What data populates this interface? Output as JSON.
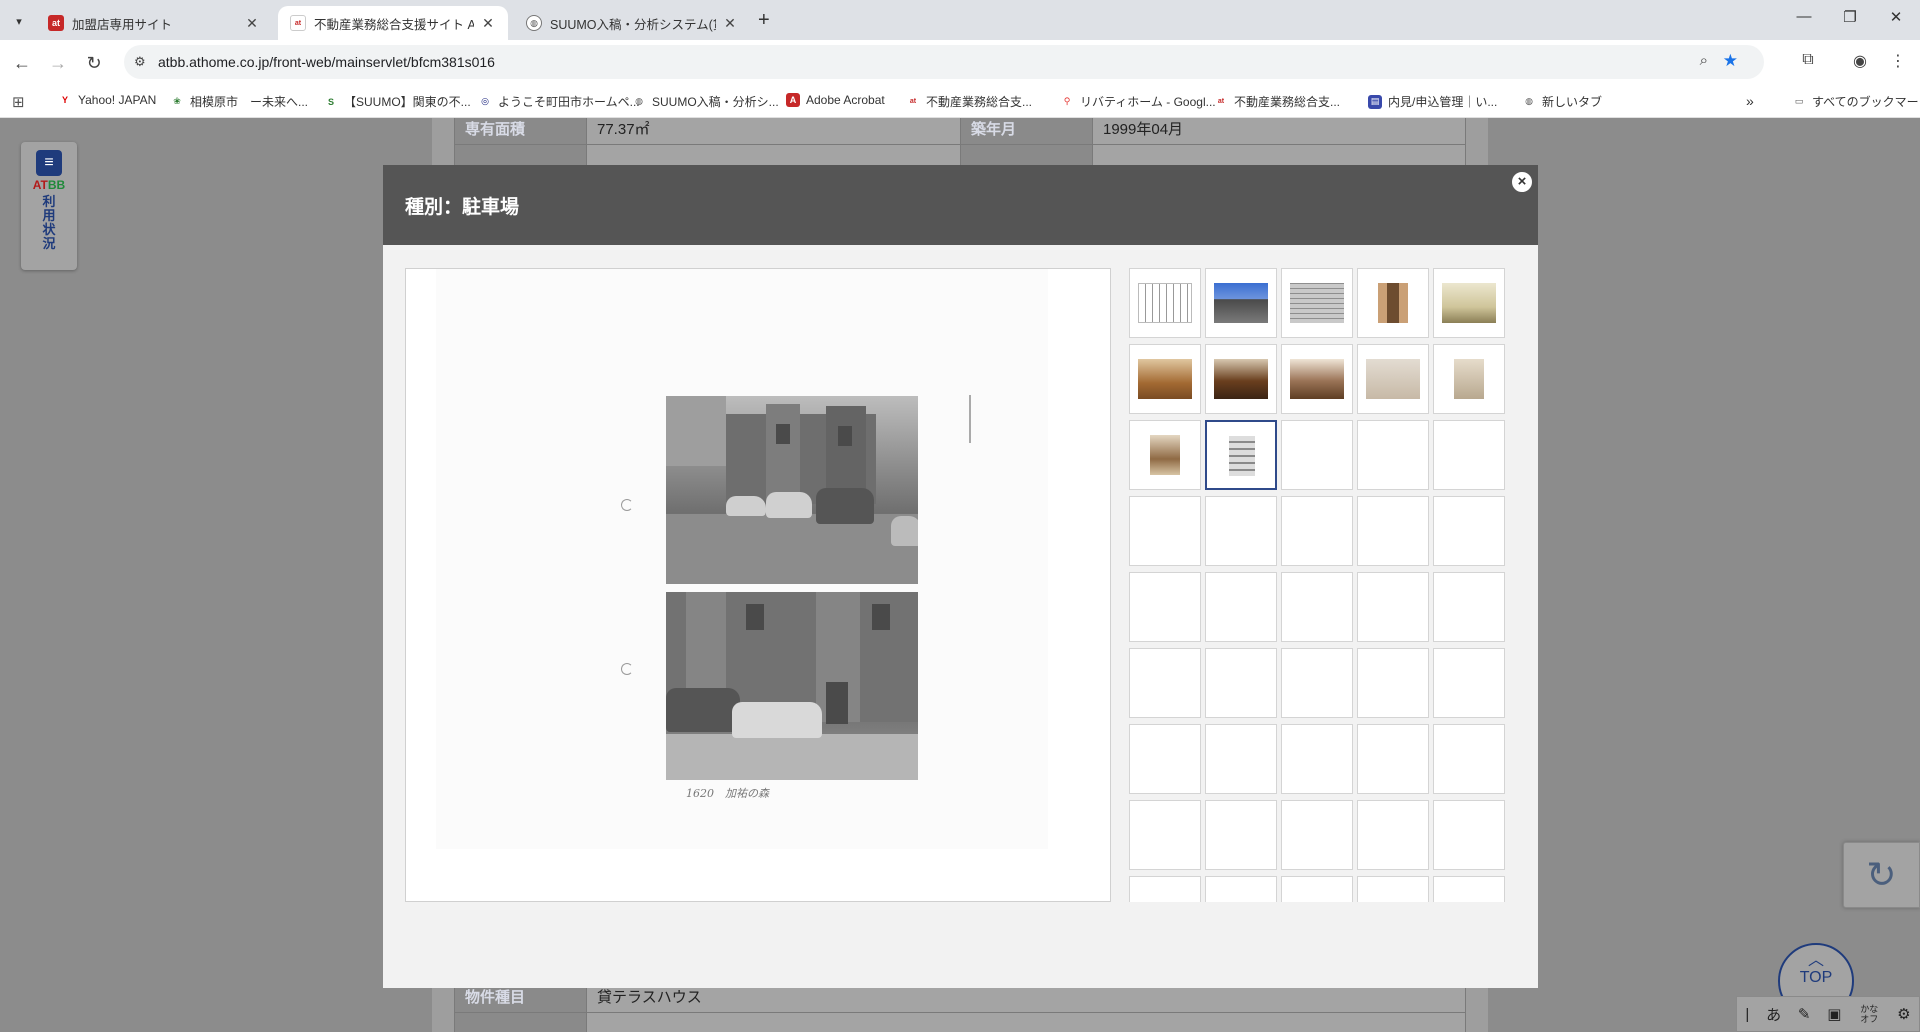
{
  "browser": {
    "tabs": [
      {
        "title": "加盟店専用サイト",
        "favicon": "at",
        "active": false
      },
      {
        "title": "不動産業務総合支援サイト ATB",
        "favicon": "athome",
        "active": true
      },
      {
        "title": "SUUMO入稿・分析システム(賃貸)",
        "favicon": "globe",
        "active": false
      }
    ],
    "url": "atbb.athome.co.jp/front-web/mainservlet/bfcm381s016",
    "bookmarks": [
      "Yahoo! JAPAN",
      "相模原市　ー未来へ...",
      "【SUUMO】関東の不...",
      "ようこそ町田市ホームペ...",
      "SUUMO入稿・分析シ...",
      "Adobe Acrobat",
      "不動産業務総合支...",
      "リバティホーム - Googl...",
      "不動産業務総合支...",
      "内見/申込管理｜い...",
      "新しいタブ"
    ],
    "all_bookmarks": "すべてのブックマーク"
  },
  "page": {
    "rows_top": [
      {
        "label1": "専有面積",
        "value1": "77.37㎡",
        "label2": "築年月",
        "value2": "1999年04月"
      }
    ],
    "rows_bottom": [
      {
        "label": "物件種目",
        "value": "貸テラスハウス"
      }
    ],
    "side_widget": {
      "brand_a": "AT",
      "brand_b": "BB",
      "label": "利用状況"
    },
    "top_button": "TOP",
    "ime": [
      "あ",
      "かな オフ"
    ]
  },
  "modal": {
    "title": "種別：駐車場",
    "close": "×",
    "photo_caption": "1620　加祐の森",
    "thumbnails_filled": 12,
    "selected_thumbnail": 12
  }
}
